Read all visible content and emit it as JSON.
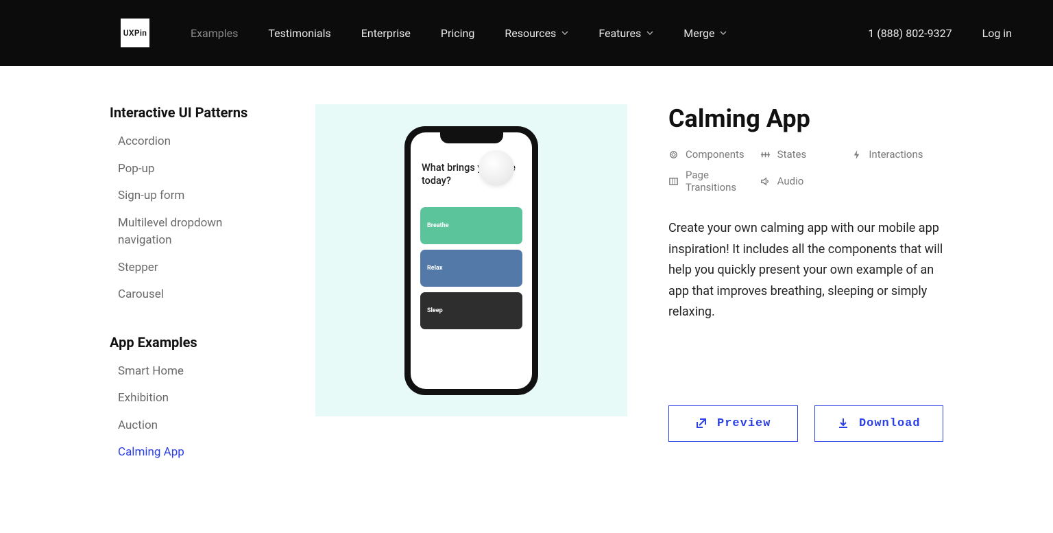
{
  "header": {
    "logo_text": "UXPin",
    "nav": [
      {
        "label": "Examples",
        "dropdown": false,
        "faded": true
      },
      {
        "label": "Testimonials",
        "dropdown": false
      },
      {
        "label": "Enterprise",
        "dropdown": false
      },
      {
        "label": "Pricing",
        "dropdown": false
      },
      {
        "label": "Resources",
        "dropdown": true
      },
      {
        "label": "Features",
        "dropdown": true
      },
      {
        "label": "Merge",
        "dropdown": true
      }
    ],
    "phone": "1 (888) 802-9327",
    "login": "Log in"
  },
  "sidebar": {
    "sections": [
      {
        "title": "Interactive UI Patterns",
        "items": [
          "Accordion",
          "Pop-up",
          "Sign-up form",
          "Multilevel dropdown navigation",
          "Stepper",
          "Carousel"
        ]
      },
      {
        "title": "App Examples",
        "items": [
          "Smart Home",
          "Exhibition",
          "Auction",
          "Calming App"
        ],
        "active_index": 3
      }
    ]
  },
  "preview": {
    "question": "What brings you here today?",
    "cards": [
      {
        "label": "Breathe",
        "color": "green"
      },
      {
        "label": "Relax",
        "color": "blue"
      },
      {
        "label": "Sleep",
        "color": "dark"
      }
    ]
  },
  "detail": {
    "title": "Calming App",
    "meta": [
      {
        "icon": "components",
        "label": "Components"
      },
      {
        "icon": "states",
        "label": "States"
      },
      {
        "icon": "interactions",
        "label": "Interactions"
      },
      {
        "icon": "transitions",
        "label": "Page Transitions"
      },
      {
        "icon": "audio",
        "label": "Audio"
      }
    ],
    "description": "Create your own calming app with our mobile app inspiration! It includes all the components that will help you quickly present your own example of an app that improves breathing, sleeping or simply relaxing.",
    "preview_btn": "Preview",
    "download_btn": "Download"
  }
}
